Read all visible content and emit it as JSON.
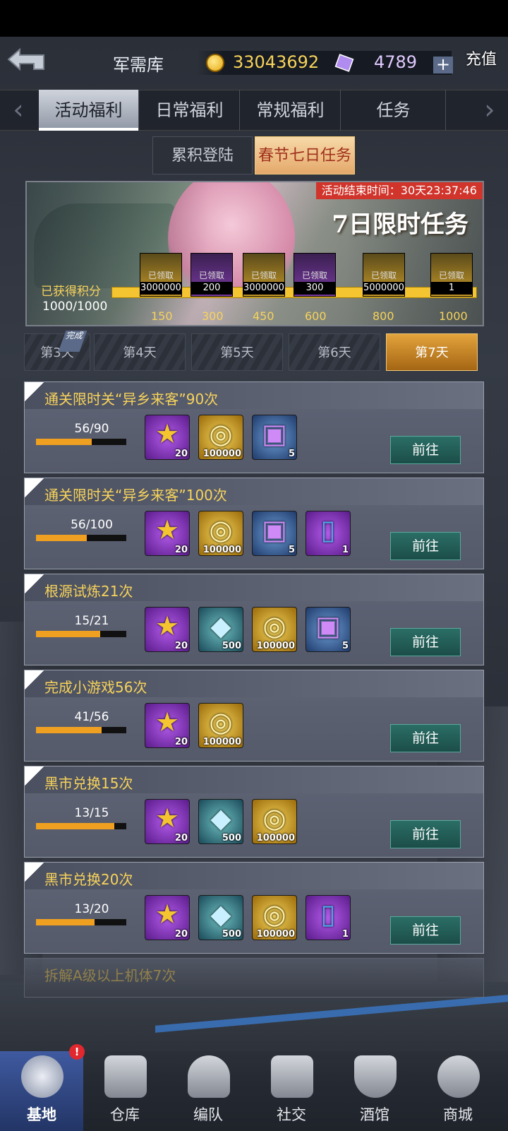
{
  "header": {
    "title": "军需库",
    "coins": "33043692",
    "gems": "4789",
    "plus": "+",
    "recharge": "充值"
  },
  "tabs": [
    {
      "label": "活动福利"
    },
    {
      "label": "日常福利"
    },
    {
      "label": "常规福利"
    },
    {
      "label": "任务"
    }
  ],
  "subtabs": [
    {
      "label": "累积登陆"
    },
    {
      "label": "春节七日任务"
    }
  ],
  "banner": {
    "timer": "活动结束时间：30天23:37:46",
    "title": "7日限时任务",
    "points_label": "已获得积分",
    "points_value": "1000/1000",
    "chests": [
      {
        "status": "已领取",
        "amount": "3000000"
      },
      {
        "status": "已领取",
        "amount": "200"
      },
      {
        "status": "已领取",
        "amount": "3000000"
      },
      {
        "status": "已领取",
        "amount": "300"
      },
      {
        "status": "已领取",
        "amount": "5000000"
      },
      {
        "status": "已领取",
        "amount": "1"
      }
    ],
    "ticks": [
      "150",
      "300",
      "450",
      "600",
      "800",
      "1000"
    ]
  },
  "days": [
    {
      "label": "第3天",
      "badge": "完成"
    },
    {
      "label": "第4天"
    },
    {
      "label": "第5天"
    },
    {
      "label": "第6天"
    },
    {
      "label": "第7天"
    }
  ],
  "tasks": [
    {
      "title": "通关限时关“异乡来客”90次",
      "progress": "56/90",
      "ratio": 0.62,
      "rewards": [
        {
          "icon": "star-coin",
          "count": "20"
        },
        {
          "icon": "gold-coins",
          "count": "100000"
        },
        {
          "icon": "gift-box",
          "count": "5"
        }
      ],
      "go": "前往"
    },
    {
      "title": "通关限时关“异乡来客”100次",
      "progress": "56/100",
      "ratio": 0.56,
      "rewards": [
        {
          "icon": "star-coin",
          "count": "20"
        },
        {
          "icon": "gold-coins",
          "count": "100000"
        },
        {
          "icon": "gift-box",
          "count": "5"
        },
        {
          "icon": "card",
          "count": "1"
        }
      ],
      "go": "前往"
    },
    {
      "title": "根源试炼21次",
      "progress": "15/21",
      "ratio": 0.71,
      "rewards": [
        {
          "icon": "star-coin",
          "count": "20"
        },
        {
          "icon": "crystal",
          "count": "500"
        },
        {
          "icon": "gold-coins",
          "count": "100000"
        },
        {
          "icon": "gift-box",
          "count": "5"
        }
      ],
      "go": "前往"
    },
    {
      "title": "完成小游戏56次",
      "progress": "41/56",
      "ratio": 0.73,
      "rewards": [
        {
          "icon": "star-coin",
          "count": "20"
        },
        {
          "icon": "gold-coins",
          "count": "100000"
        }
      ],
      "go": "前往"
    },
    {
      "title": "黑市兑换15次",
      "progress": "13/15",
      "ratio": 0.87,
      "rewards": [
        {
          "icon": "star-coin",
          "count": "20"
        },
        {
          "icon": "crystal",
          "count": "500"
        },
        {
          "icon": "gold-coins",
          "count": "100000"
        }
      ],
      "go": "前往"
    },
    {
      "title": "黑市兑换20次",
      "progress": "13/20",
      "ratio": 0.65,
      "rewards": [
        {
          "icon": "star-coin",
          "count": "20"
        },
        {
          "icon": "crystal",
          "count": "500"
        },
        {
          "icon": "gold-coins",
          "count": "100000"
        },
        {
          "icon": "card",
          "count": "1"
        }
      ],
      "go": "前往"
    }
  ],
  "partial_task": {
    "title": "拆解A级以上机体7次"
  },
  "nav": [
    {
      "label": "基地"
    },
    {
      "label": "仓库"
    },
    {
      "label": "编队"
    },
    {
      "label": "社交"
    },
    {
      "label": "酒馆"
    },
    {
      "label": "商城"
    }
  ],
  "alert": "!"
}
